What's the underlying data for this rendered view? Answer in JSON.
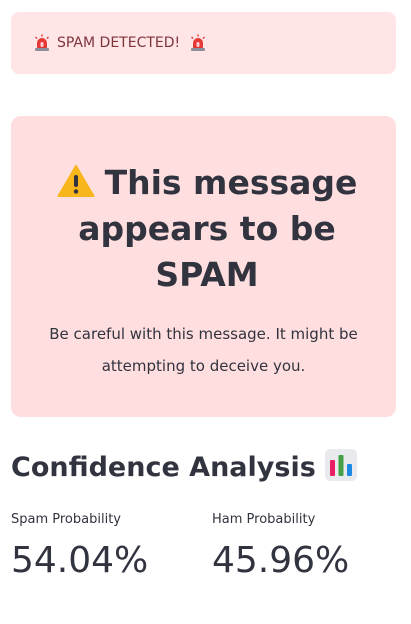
{
  "alert": {
    "text": "SPAM DETECTED!",
    "icon": "police-siren-icon",
    "accent": "#7d353b",
    "background": "#ffe5e5"
  },
  "result": {
    "icon": "warning-icon",
    "headline": "This message appears to be SPAM",
    "subtext": "Be careful with this message. It might be attempting to deceive you.",
    "background": "#ffdedf"
  },
  "analysis": {
    "title": "Confidence Analysis",
    "icon": "bar-chart-icon",
    "metrics": [
      {
        "label": "Spam Probability",
        "value": "54.04%"
      },
      {
        "label": "Ham Probability",
        "value": "45.96%"
      }
    ]
  }
}
